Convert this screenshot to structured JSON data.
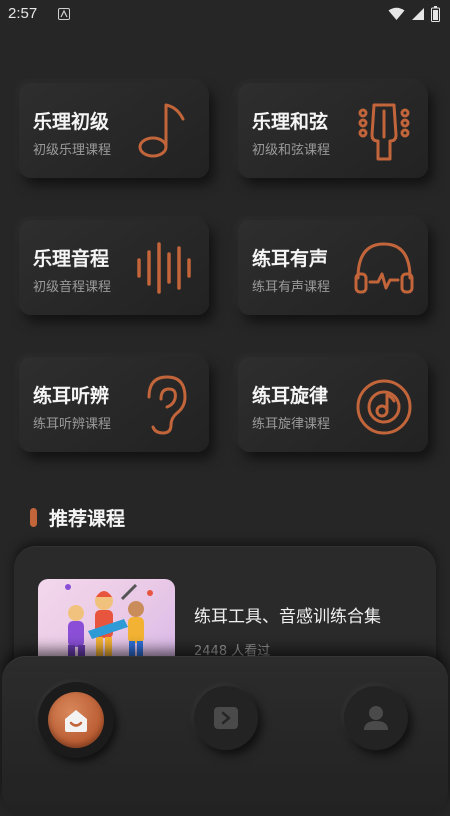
{
  "status_bar": {
    "time": "2:57"
  },
  "categories": [
    {
      "title": "乐理初级",
      "subtitle": "初级乐理课程",
      "icon": "music-note-icon"
    },
    {
      "title": "乐理和弦",
      "subtitle": "初级和弦课程",
      "icon": "guitar-head-icon"
    },
    {
      "title": "乐理音程",
      "subtitle": "初级音程课程",
      "icon": "sound-wave-icon"
    },
    {
      "title": "练耳有声",
      "subtitle": "练耳有声课程",
      "icon": "headphones-icon"
    },
    {
      "title": "练耳听辨",
      "subtitle": "练耳听辨课程",
      "icon": "ear-icon"
    },
    {
      "title": "练耳旋律",
      "subtitle": "练耳旋律课程",
      "icon": "vinyl-disc-icon"
    }
  ],
  "section": {
    "title": "推荐课程"
  },
  "course": {
    "title": "练耳工具、音感训练合集",
    "meta": "2448 人看过"
  },
  "nav": [
    {
      "label": "home",
      "icon": "home-icon",
      "active": true
    },
    {
      "label": "video",
      "icon": "play-icon",
      "active": false
    },
    {
      "label": "profile",
      "icon": "user-icon",
      "active": false
    }
  ],
  "colors": {
    "accent": "#c2653a",
    "background": "#262626",
    "card": "#2b2b2b"
  }
}
